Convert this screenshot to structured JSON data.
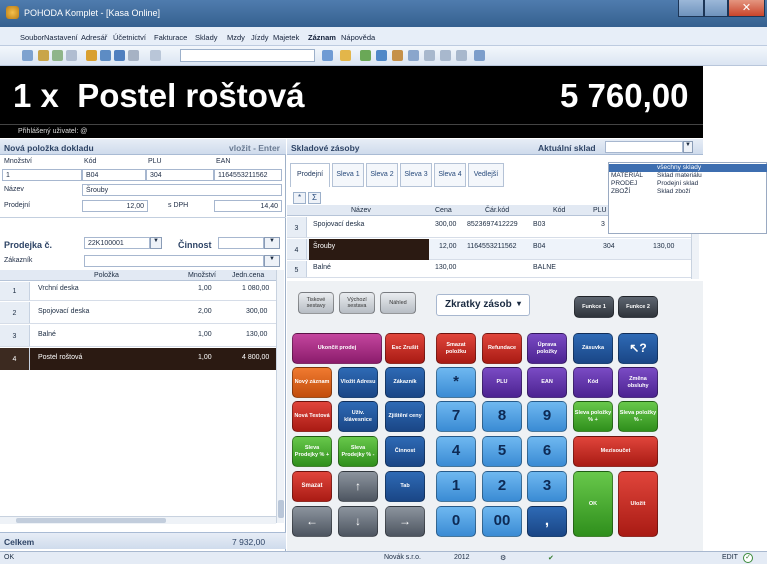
{
  "window": {
    "title": "POHODA Komplet - [Kasa Online]"
  },
  "menu": [
    "Soubor",
    "Nastavení",
    "Adresář",
    "Účetnictví",
    "Fakturace",
    "Sklady",
    "Mzdy",
    "Jízdy",
    "Majetek",
    "Záznam",
    "Nápověda"
  ],
  "display": {
    "item": "1 x  Postel roštová",
    "price": "5 760,00"
  },
  "user_bar": "Přihlášený uživatel: @",
  "new_item": {
    "header": "Nová položka dokladu",
    "hint": "vložit - Enter",
    "cols": [
      "Množství",
      "Kód",
      "PLU",
      "EAN"
    ],
    "values": [
      "1",
      "B04",
      "304",
      "1164553211562"
    ],
    "name_label": "Název",
    "name_value": "Šrouby",
    "price_label": "Prodejní",
    "price_value": "12,00",
    "vat_label": "s DPH",
    "vat_value": "14,40"
  },
  "receipt": {
    "label": "Prodejka č.",
    "number": "22K100001",
    "activity_label": "Činnost",
    "customer_label": "Zákazník",
    "cols": [
      "Položka",
      "Množství",
      "Jedn.cena"
    ],
    "rows": [
      {
        "n": "1",
        "item": "Vrchní deska",
        "qty": "1,00",
        "price": "1 080,00"
      },
      {
        "n": "2",
        "item": "Spojovací deska",
        "qty": "2,00",
        "price": "300,00"
      },
      {
        "n": "3",
        "item": "Balné",
        "qty": "1,00",
        "price": "130,00"
      },
      {
        "n": "4",
        "item": "Postel roštová",
        "qty": "1,00",
        "price": "4 800,00"
      }
    ],
    "total_label": "Celkem",
    "total": "7 932,00"
  },
  "stock": {
    "header": "Skladové zásoby",
    "warehouse_label": "Aktuální sklad",
    "tabs": [
      "Prodejní",
      "Sleva 1",
      "Sleva 2",
      "Sleva 3",
      "Sleva 4",
      "Vedlejší"
    ],
    "cols": [
      "Název",
      "Cena",
      "Čár.kód",
      "Kód",
      "PLU"
    ],
    "rows": [
      {
        "n": "3",
        "name": "Spojovací deska",
        "price": "300,00",
        "ean": "8523697412229",
        "code": "B03",
        "plu": "3"
      },
      {
        "n": "4",
        "name": "Šrouby",
        "price": "12,00",
        "ean": "1164553211562",
        "code": "B04",
        "plu": "304",
        "extra": "130,00"
      },
      {
        "n": "5",
        "name": "Balné",
        "price": "130,00",
        "ean": "",
        "code": "BALNE",
        "plu": ""
      }
    ]
  },
  "dropdown": [
    {
      "code": "",
      "name": "všechny sklady"
    },
    {
      "code": "MATERIÁL",
      "name": "Sklad materiálu"
    },
    {
      "code": "PRODEJ",
      "name": "Prodejní sklad"
    },
    {
      "code": "ZBOŽÍ",
      "name": "Sklad zboží"
    }
  ],
  "keypad": {
    "small": [
      "Tiskové sestavy",
      "Výchozí sestava",
      "Náhled"
    ],
    "shortcut": "Zkratky zásob",
    "func": [
      "Funkce 1",
      "Funkce 2"
    ],
    "keys": [
      "Ukončit prodej",
      "Esc Zrušit",
      "Smazat položku",
      "Refundace",
      "Úprava položky",
      "Zásuvka",
      "↖?",
      "Nový záznam",
      "Vložit Adresu",
      "Zákazník",
      "*",
      "PLU",
      "EAN",
      "Kód",
      "Změna obsluhy",
      "Nová Testová",
      "Uživ. klávesnice",
      "Zjištění ceny",
      "7",
      "8",
      "9",
      "Sleva položky % +",
      "Sleva položky % -",
      "Sleva Prodejky % +",
      "Sleva Prodejky % -",
      "Činnost",
      "4",
      "5",
      "6",
      "Mezisoučet",
      "Smazat",
      "↑",
      "Tab",
      "1",
      "2",
      "3",
      "OK",
      "Uložit",
      "←",
      "↓",
      "→",
      "0",
      "00",
      ","
    ]
  },
  "status": {
    "left": "OK",
    "company": "Novák s.r.o.",
    "year": "2012",
    "mode": "EDIT"
  }
}
